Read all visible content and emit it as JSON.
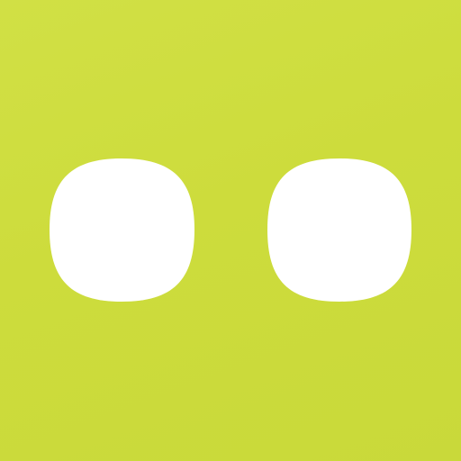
{
  "app_icon": {
    "icon_name": "two-dots-icon",
    "background_color": "#cddc3c",
    "dot_color": "#ffffff"
  }
}
